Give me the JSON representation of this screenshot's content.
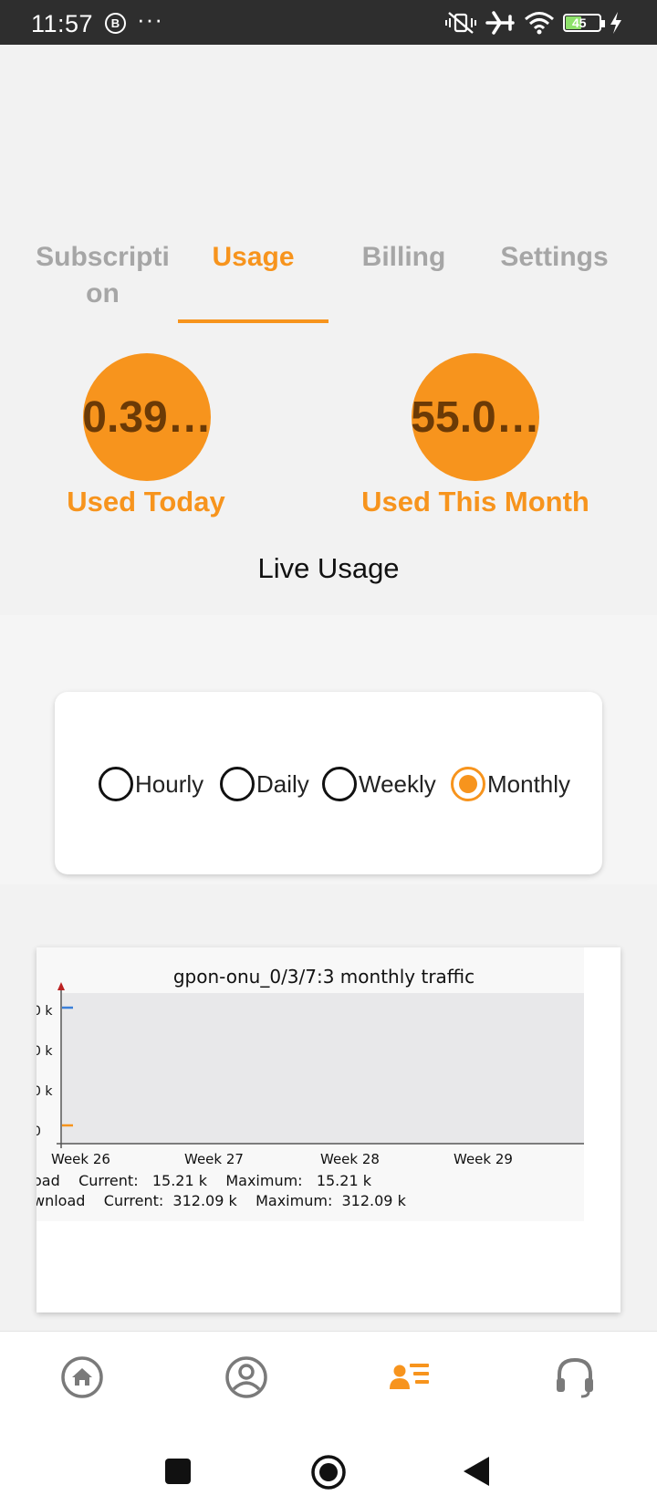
{
  "status_bar": {
    "time": "11:57",
    "badge_letter": "B",
    "overflow": "···",
    "battery": "45",
    "icons": [
      "vibrate-off-icon",
      "airplane-icon",
      "wifi-icon",
      "battery-icon",
      "charging-icon"
    ]
  },
  "tabs": [
    {
      "label": "Subscripti\non",
      "active": false
    },
    {
      "label": "Usage",
      "active": true
    },
    {
      "label": "Billing",
      "active": false
    },
    {
      "label": "Settings",
      "active": false
    }
  ],
  "usage": {
    "today_value": "0.39…",
    "today_label": "Used Today",
    "month_value": "55.0…",
    "month_label": "Used This Month",
    "live_label": "Live Usage"
  },
  "period_options": [
    {
      "label": "Hourly",
      "selected": false
    },
    {
      "label": "Daily",
      "selected": false
    },
    {
      "label": "Weekly",
      "selected": false
    },
    {
      "label": "Monthly",
      "selected": true
    }
  ],
  "chart": {
    "title": "gpon-onu_0/3/7:3 monthly traffic",
    "y_ticks": [
      "0 k",
      "0 k",
      "0 k",
      "0"
    ],
    "x_ticks": [
      "Week 26",
      "Week 27",
      "Week 28",
      "Week 29"
    ],
    "legend": [
      "oad    Current:   15.21 k    Maximum:   15.21 k",
      "wnload    Current:  312.09 k    Maximum:  312.09 k"
    ]
  },
  "chart_data": {
    "type": "line",
    "title": "gpon-onu_0/3/7:3 monthly traffic",
    "categories": [
      "Week 26",
      "Week 27",
      "Week 28",
      "Week 29"
    ],
    "series": [
      {
        "name": "Upload",
        "color": "#f7941d",
        "current": "15.21 k",
        "maximum": "15.21 k"
      },
      {
        "name": "Download",
        "color": "#3b7fd9",
        "current": "312.09 k",
        "maximum": "312.09 k"
      }
    ]
  },
  "colors": {
    "accent": "#f7941d",
    "inactive": "#a6a6a6"
  },
  "bottom_nav": [
    {
      "icon": "home-icon",
      "active": false
    },
    {
      "icon": "profile-icon",
      "active": false
    },
    {
      "icon": "account-list-icon",
      "active": true
    },
    {
      "icon": "headset-icon",
      "active": false
    }
  ]
}
